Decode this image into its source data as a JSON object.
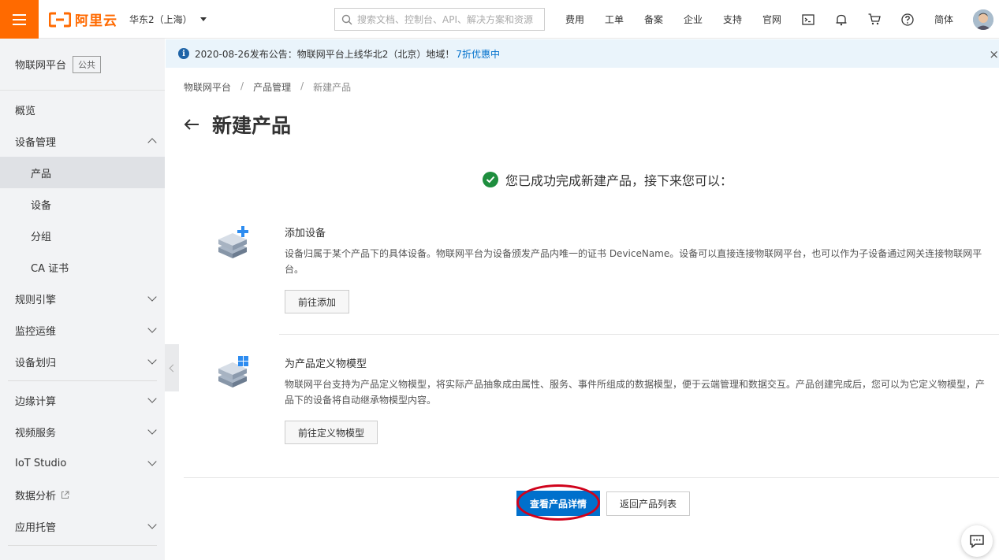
{
  "header": {
    "logo_text": "阿里云",
    "region": "华东2（上海）",
    "search_placeholder": "搜索文档、控制台、API、解决方案和资源",
    "links": [
      "费用",
      "工单",
      "备案",
      "企业",
      "支持",
      "官网"
    ],
    "icons": [
      "terminal-icon",
      "bell-icon",
      "cart-icon",
      "help-icon"
    ],
    "language": "简体"
  },
  "sidebar": {
    "title": "物联网平台",
    "tag": "公共",
    "items": [
      {
        "label": "概览"
      },
      {
        "label": "设备管理"
      },
      {
        "label": "产品"
      },
      {
        "label": "设备"
      },
      {
        "label": "分组"
      },
      {
        "label": "CA 证书"
      },
      {
        "label": "规则引擎"
      },
      {
        "label": "监控运维"
      },
      {
        "label": "设备划归"
      },
      {
        "label": "边缘计算"
      },
      {
        "label": "视频服务"
      },
      {
        "label": "IoT Studio"
      },
      {
        "label": "数据分析"
      },
      {
        "label": "应用托管"
      }
    ]
  },
  "notice": {
    "text": "2020-08-26发布公告：物联网平台上线华北2（北京）地域！",
    "link": "7折优惠中",
    "close": "×"
  },
  "breadcrumb": [
    "物联网平台",
    "产品管理",
    "新建产品"
  ],
  "breadcrumb_sep": "/",
  "page": {
    "title": "新建产品",
    "success_text": "您已成功完成新建产品，接下来您可以：",
    "cards": [
      {
        "title": "添加设备",
        "desc": "设备归属于某个产品下的具体设备。物联网平台为设备颁发产品内唯一的证书 DeviceName。设备可以直接连接物联网平台，也可以作为子设备通过网关连接物联网平台。",
        "button": "前往添加"
      },
      {
        "title": "为产品定义物模型",
        "desc": "物联网平台支持为产品定义物模型，将实际产品抽象成由属性、服务、事件所组成的数据模型，便于云端管理和数据交互。产品创建完成后，您可以为它定义物模型，产品下的设备将自动继承物模型内容。",
        "button": "前往定义物模型"
      }
    ],
    "primary_button": "查看产品详情",
    "secondary_button": "返回产品列表"
  },
  "colors": {
    "brand": "#ff6a00",
    "primary": "#0070cc",
    "success": "#1e8e3e",
    "annotation_ring": "#d0021b"
  }
}
